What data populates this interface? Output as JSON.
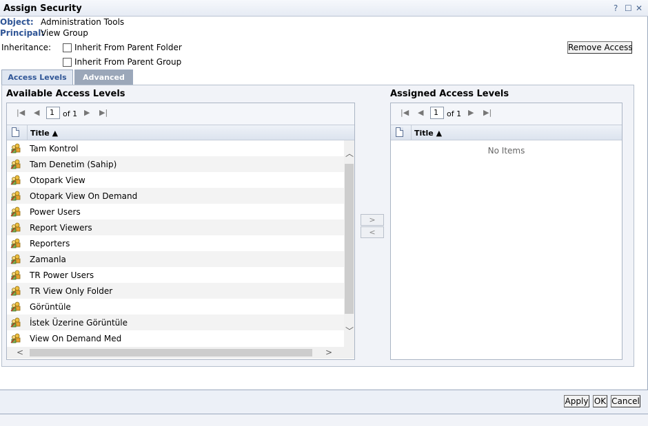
{
  "window": {
    "title": "Assign Security",
    "help_label": "?",
    "maximize_label": "☐",
    "close_label": "✕"
  },
  "info": {
    "object_label": "Object:",
    "object_value": "Administration Tools",
    "principal_label": "Principal:",
    "principal_value": "View Group",
    "inheritance_label": "Inheritance:",
    "inherit_folder_label": "Inherit From Parent Folder",
    "inherit_group_label": "Inherit From Parent Group",
    "inherit_folder_checked": false,
    "inherit_group_checked": false
  },
  "remove_access_label": "Remove Access",
  "tabs": [
    {
      "label": "Access Levels",
      "active": true
    },
    {
      "label": "Advanced",
      "active": false
    }
  ],
  "available": {
    "title": "Available Access Levels",
    "page": "1",
    "of_label": "of 1",
    "column_title": "Title ▲",
    "items": [
      "Tam Kontrol",
      "Tam Denetim (Sahip)",
      "Otopark View",
      "Otopark View On Demand",
      "Power Users",
      "Report Viewers",
      "Reporters",
      "Zamanla",
      "TR Power Users",
      "TR View Only Folder",
      "Görüntüle",
      "İstek Üzerine Görüntüle",
      "View On Demand Med"
    ]
  },
  "assigned": {
    "title": "Assigned Access Levels",
    "page": "1",
    "of_label": "of 1",
    "column_title": "Title ▲",
    "empty_text": "No Items"
  },
  "move": {
    "add_label": ">",
    "remove_label": "<"
  },
  "footer": {
    "apply_label": "Apply",
    "ok_label": "OK",
    "cancel_label": "Cancel"
  },
  "icons": {
    "pager_first": "first-page-icon",
    "pager_prev": "prev-page-icon",
    "pager_next": "next-page-icon",
    "pager_last": "last-page-icon",
    "access_level": "access-level-icon",
    "column_doc": "document-icon"
  },
  "colors": {
    "accent": "#2f5596",
    "tab_inactive": "#9ba7b9"
  }
}
